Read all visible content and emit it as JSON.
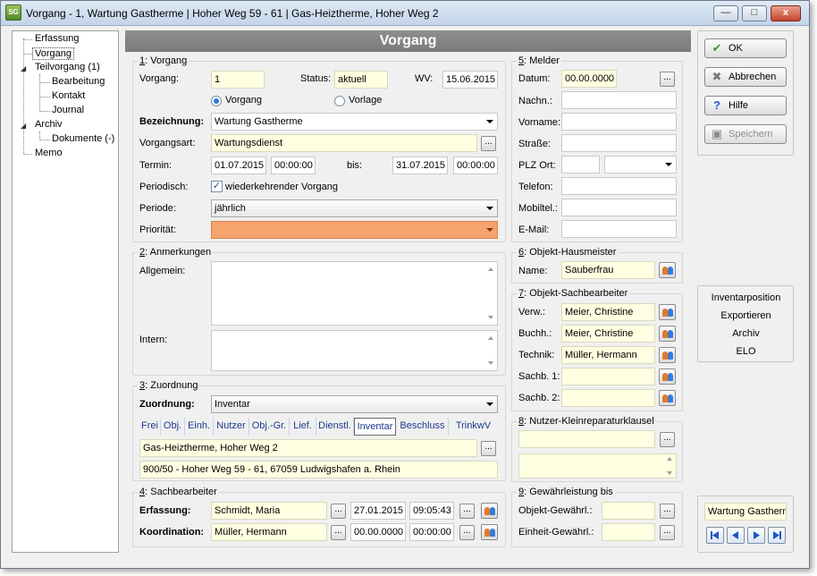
{
  "window": {
    "title": "Vorgang - 1, Wartung Gastherme | Hoher Weg 59 - 61 | Gas-Heiztherme, Hoher Weg 2",
    "icon_text": "SG",
    "minimize": "—",
    "maximize": "□",
    "close": "x"
  },
  "tree": {
    "items": [
      {
        "label": "Erfassung"
      },
      {
        "label": "Vorgang"
      },
      {
        "label": "Teilvorgang (1)"
      },
      {
        "label": "Bearbeitung"
      },
      {
        "label": "Kontakt"
      },
      {
        "label": "Journal"
      },
      {
        "label": "Archiv"
      },
      {
        "label": "Dokumente (-)"
      },
      {
        "label": "Memo"
      }
    ]
  },
  "header": {
    "title": "Vorgang"
  },
  "section1": {
    "legend_num": "1",
    "legend": ": Vorgang",
    "vorgang_label": "Vorgang:",
    "vorgang_value": "1",
    "status_label": "Status:",
    "status_value": "aktuell",
    "wv_label": "WV:",
    "wv_value": "15.06.2015",
    "radio_vorgang": "Vorgang",
    "radio_vorlage": "Vorlage",
    "bezeichnung_label": "Bezeichnung:",
    "bezeichnung_value": "Wartung Gastherme",
    "vorgangsart_label": "Vorgangsart:",
    "vorgangsart_value": "Wartungsdienst",
    "termin_label": "Termin:",
    "termin_date": "01.07.2015",
    "termin_time": "00:00:00",
    "bis_label": "bis:",
    "bis_date": "31.07.2015",
    "bis_time": "00:00:00",
    "periodisch_label": "Periodisch:",
    "periodisch_check": "✓",
    "periodisch_text": "wiederkehrender Vorgang",
    "periode_label": "Periode:",
    "periode_value": "jährlich",
    "prioritaet_label": "Priorität:",
    "prioritaet_value": ""
  },
  "section2": {
    "legend_num": "2",
    "legend": ": Anmerkungen",
    "allgemein_label": "Allgemein:",
    "intern_label": "Intern:"
  },
  "section3": {
    "legend_num": "3",
    "legend": ": Zuordnung",
    "zuordnung_label": "Zuordnung:",
    "zuordnung_value": "Inventar",
    "tabs": [
      "Frei",
      "Obj.",
      "Einh.",
      "Nutzer",
      "Obj.-Gr.",
      "Lief.",
      "Dienstl.",
      "Inventar",
      "Beschluss",
      "TrinkwV"
    ],
    "line1": "Gas-Heiztherme, Hoher Weg 2",
    "line2": "900/50 - Hoher Weg 59 - 61, 67059 Ludwigshafen a. Rhein"
  },
  "section4": {
    "legend_num": "4",
    "legend": ": Sachbearbeiter",
    "erfassung_label": "Erfassung:",
    "erfassung_name": "Schmidt, Maria",
    "erfassung_date": "27.01.2015",
    "erfassung_time": "09:05:43",
    "koordination_label": "Koordination:",
    "koordination_name": "Müller, Hermann",
    "koordination_date": "00.00.0000",
    "koordination_time": "00:00:00"
  },
  "section5": {
    "legend_num": "5",
    "legend": ": Melder",
    "datum_label": "Datum:",
    "datum_value": "00.00.0000",
    "nachn_label": "Nachn.:",
    "vorname_label": "Vorname:",
    "strasse_label": "Straße:",
    "plz_label": "PLZ Ort:",
    "telefon_label": "Telefon:",
    "mobil_label": "Mobiltel.:",
    "email_label": "E-Mail:"
  },
  "section6": {
    "legend_num": "6",
    "legend": ": Objekt-Hausmeister",
    "name_label": "Name:",
    "name_value": "Sauberfrau"
  },
  "section7": {
    "legend_num": "7",
    "legend": ": Objekt-Sachbearbeiter",
    "verw_label": "Verw.:",
    "verw_value": "Meier, Christine",
    "buchh_label": "Buchh.:",
    "buchh_value": "Meier, Christine",
    "technik_label": "Technik:",
    "technik_value": "Müller, Hermann",
    "sachb1_label": "Sachb. 1:",
    "sachb2_label": "Sachb. 2:"
  },
  "section8": {
    "legend_num": "8",
    "legend": ": Nutzer-Kleinreparaturklausel"
  },
  "section9": {
    "legend_num": "9",
    "legend": ": Gewährleistung bis",
    "objekt_label": "Objekt-Gewährl.:",
    "einheit_label": "Einheit-Gewährl.:"
  },
  "actions": {
    "ok": "OK",
    "abbrechen": "Abbrechen",
    "hilfe": "Hilfe",
    "speichern": "Speichern"
  },
  "side_links": [
    "Inventarposition",
    "Exportieren",
    "Archiv",
    "ELO"
  ],
  "record_nav": {
    "current": "Wartung Gastherme"
  },
  "ellipsis": "...",
  "colors": {
    "header": "#7f7f7f",
    "yellow_field": "#ffffe1",
    "priority": "#f4a46c",
    "tab_text": "#1a3a8c"
  }
}
